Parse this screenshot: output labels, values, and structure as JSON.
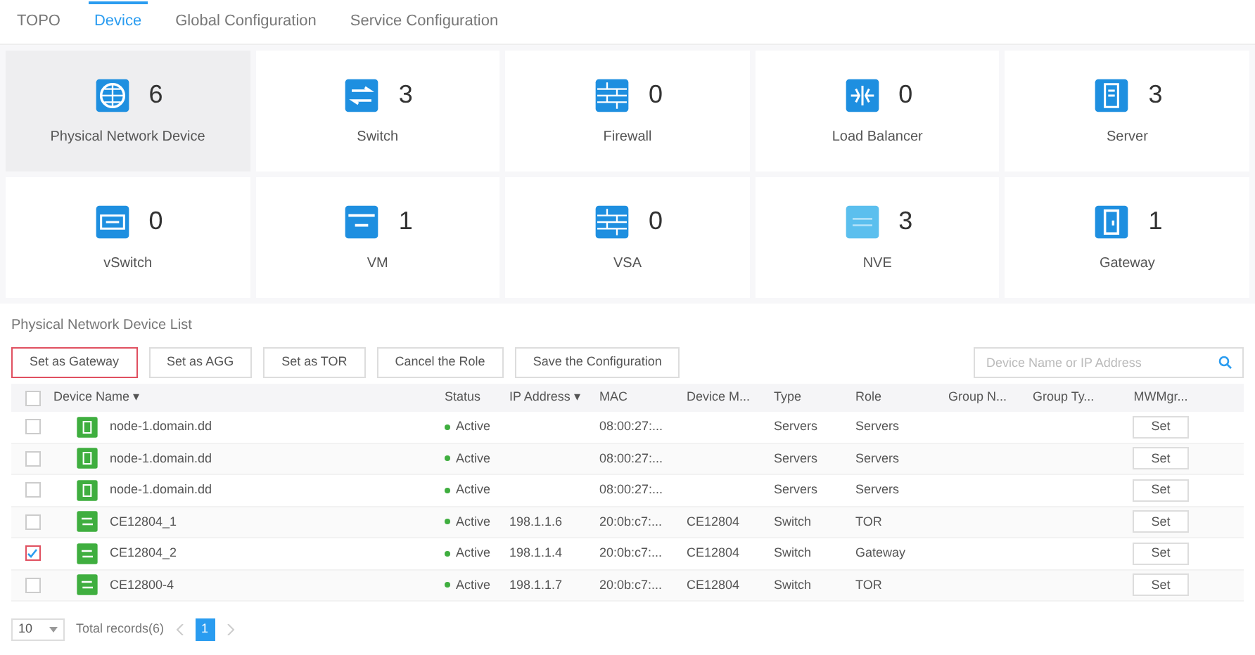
{
  "tabs": [
    {
      "label": "TOPO",
      "selected": false
    },
    {
      "label": "Device",
      "selected": true
    },
    {
      "label": "Global Configuration",
      "selected": false
    },
    {
      "label": "Service Configuration",
      "selected": false
    }
  ],
  "tiles": [
    {
      "kind": "globe",
      "count": "6",
      "label": "Physical Network Device",
      "selected": true
    },
    {
      "kind": "switch",
      "count": "3",
      "label": "Switch",
      "selected": false
    },
    {
      "kind": "firewall",
      "count": "0",
      "label": "Firewall",
      "selected": false
    },
    {
      "kind": "balancer",
      "count": "0",
      "label": "Load Balancer",
      "selected": false
    },
    {
      "kind": "server",
      "count": "3",
      "label": "Server",
      "selected": false
    },
    {
      "kind": "vswitch",
      "count": "0",
      "label": "vSwitch",
      "selected": false
    },
    {
      "kind": "vm",
      "count": "1",
      "label": "VM",
      "selected": false
    },
    {
      "kind": "firewall",
      "count": "0",
      "label": "VSA",
      "selected": false
    },
    {
      "kind": "nve",
      "count": "3",
      "label": "NVE",
      "selected": false
    },
    {
      "kind": "gateway",
      "count": "1",
      "label": "Gateway",
      "selected": false
    }
  ],
  "list_title": "Physical Network Device List",
  "toolbar": [
    {
      "label": "Set as Gateway",
      "highlighted": true
    },
    {
      "label": "Set as AGG",
      "highlighted": false
    },
    {
      "label": "Set as TOR",
      "highlighted": false
    },
    {
      "label": "Cancel the Role",
      "highlighted": false
    },
    {
      "label": "Save the Configuration",
      "highlighted": false
    }
  ],
  "search": {
    "placeholder": "Device Name or IP Address"
  },
  "table": {
    "all_checked": false,
    "columns": [
      "Device Name ▾",
      "Status",
      "IP Address ▾",
      "MAC",
      "Device M...",
      "Type",
      "Role",
      "Group N...",
      "Group Ty...",
      "MWMgr..."
    ],
    "rows": [
      {
        "kind": "server",
        "checked": false,
        "cells": [
          "node-1.domain.dd",
          "Active",
          "",
          "08:00:27:...",
          "",
          "Servers",
          "Servers",
          "",
          "",
          ""
        ],
        "action": "Set"
      },
      {
        "kind": "server",
        "checked": false,
        "cells": [
          "node-1.domain.dd",
          "Active",
          "",
          "08:00:27:...",
          "",
          "Servers",
          "Servers",
          "",
          "",
          ""
        ],
        "action": "Set"
      },
      {
        "kind": "server",
        "checked": false,
        "cells": [
          "node-1.domain.dd",
          "Active",
          "",
          "08:00:27:...",
          "",
          "Servers",
          "Servers",
          "",
          "",
          ""
        ],
        "action": "Set"
      },
      {
        "kind": "switch",
        "checked": false,
        "cells": [
          "CE12804_1",
          "Active",
          "198.1.1.6",
          "20:0b:c7:...",
          "CE12804",
          "Switch",
          "TOR",
          "",
          "",
          ""
        ],
        "action": "Set"
      },
      {
        "kind": "switch",
        "checked": true,
        "cells": [
          "CE12804_2",
          "Active",
          "198.1.1.4",
          "20:0b:c7:...",
          "CE12804",
          "Switch",
          "Gateway",
          "",
          "",
          ""
        ],
        "action": "Set"
      },
      {
        "kind": "switch",
        "checked": false,
        "cells": [
          "CE12800-4",
          "Active",
          "198.1.1.7",
          "20:0b:c7:...",
          "CE12804",
          "Switch",
          "TOR",
          "",
          "",
          ""
        ],
        "action": "Set"
      }
    ]
  },
  "pagination": {
    "page_size": "10",
    "total": "Total records(6)",
    "pages": [
      {
        "label": "1",
        "selected": true
      }
    ]
  }
}
